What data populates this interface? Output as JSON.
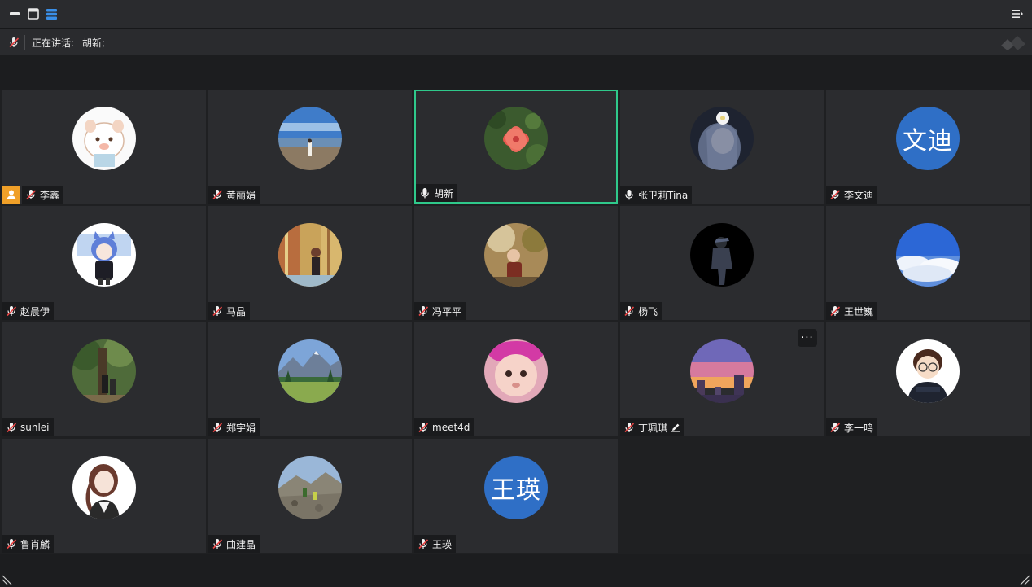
{
  "speaker_bar": {
    "label": "正在讲话:",
    "speaker": "胡新;"
  },
  "participants": [
    {
      "name": "李鑫",
      "mic": "muted",
      "host": true,
      "avatar": "cartoon-pig"
    },
    {
      "name": "黄丽娟",
      "mic": "muted",
      "avatar": "beach-photo"
    },
    {
      "name": "胡新",
      "mic": "on",
      "active": true,
      "avatar": "red-flower"
    },
    {
      "name": "张卫莉Tina",
      "mic": "on",
      "avatar": "anime-girl"
    },
    {
      "name": "李文迪",
      "mic": "muted",
      "initials": "文迪"
    },
    {
      "name": "赵晨伊",
      "mic": "muted",
      "avatar": "anime-cat-girl"
    },
    {
      "name": "马晶",
      "mic": "muted",
      "avatar": "temple-photo"
    },
    {
      "name": "冯平平",
      "mic": "muted",
      "avatar": "child-photo"
    },
    {
      "name": "杨飞",
      "mic": "muted",
      "avatar": "silhouette-dark"
    },
    {
      "name": "王世巍",
      "mic": "muted",
      "avatar": "clouds-sky"
    },
    {
      "name": "sunlei",
      "mic": "muted",
      "avatar": "forest-photo"
    },
    {
      "name": "郑宇娟",
      "mic": "muted",
      "avatar": "mountain-lake"
    },
    {
      "name": "meet4d",
      "mic": "muted",
      "avatar": "baby-photo"
    },
    {
      "name": "丁珮琪",
      "mic": "muted",
      "editing": true,
      "more": "···",
      "avatar": "sunset-city"
    },
    {
      "name": "李一鸣",
      "mic": "muted",
      "avatar": "cartoon-boy"
    },
    {
      "name": "鲁肖麟",
      "mic": "muted",
      "avatar": "anime-woman"
    },
    {
      "name": "曲建晶",
      "mic": "muted",
      "avatar": "hiking-photo"
    },
    {
      "name": "王瑛",
      "mic": "muted",
      "initials": "王瑛"
    }
  ],
  "colors": {
    "active_border": "#2fc98b",
    "host_badge": "#f0a028",
    "initials_bg": "#2f6fc6",
    "tile_bg": "#2b2c2f"
  },
  "icons": {
    "titlebar": [
      "minimize-icon",
      "window-icon",
      "grid-view-icon",
      "menu-collapse-icon"
    ],
    "speaker": "mic-muted-icon"
  }
}
